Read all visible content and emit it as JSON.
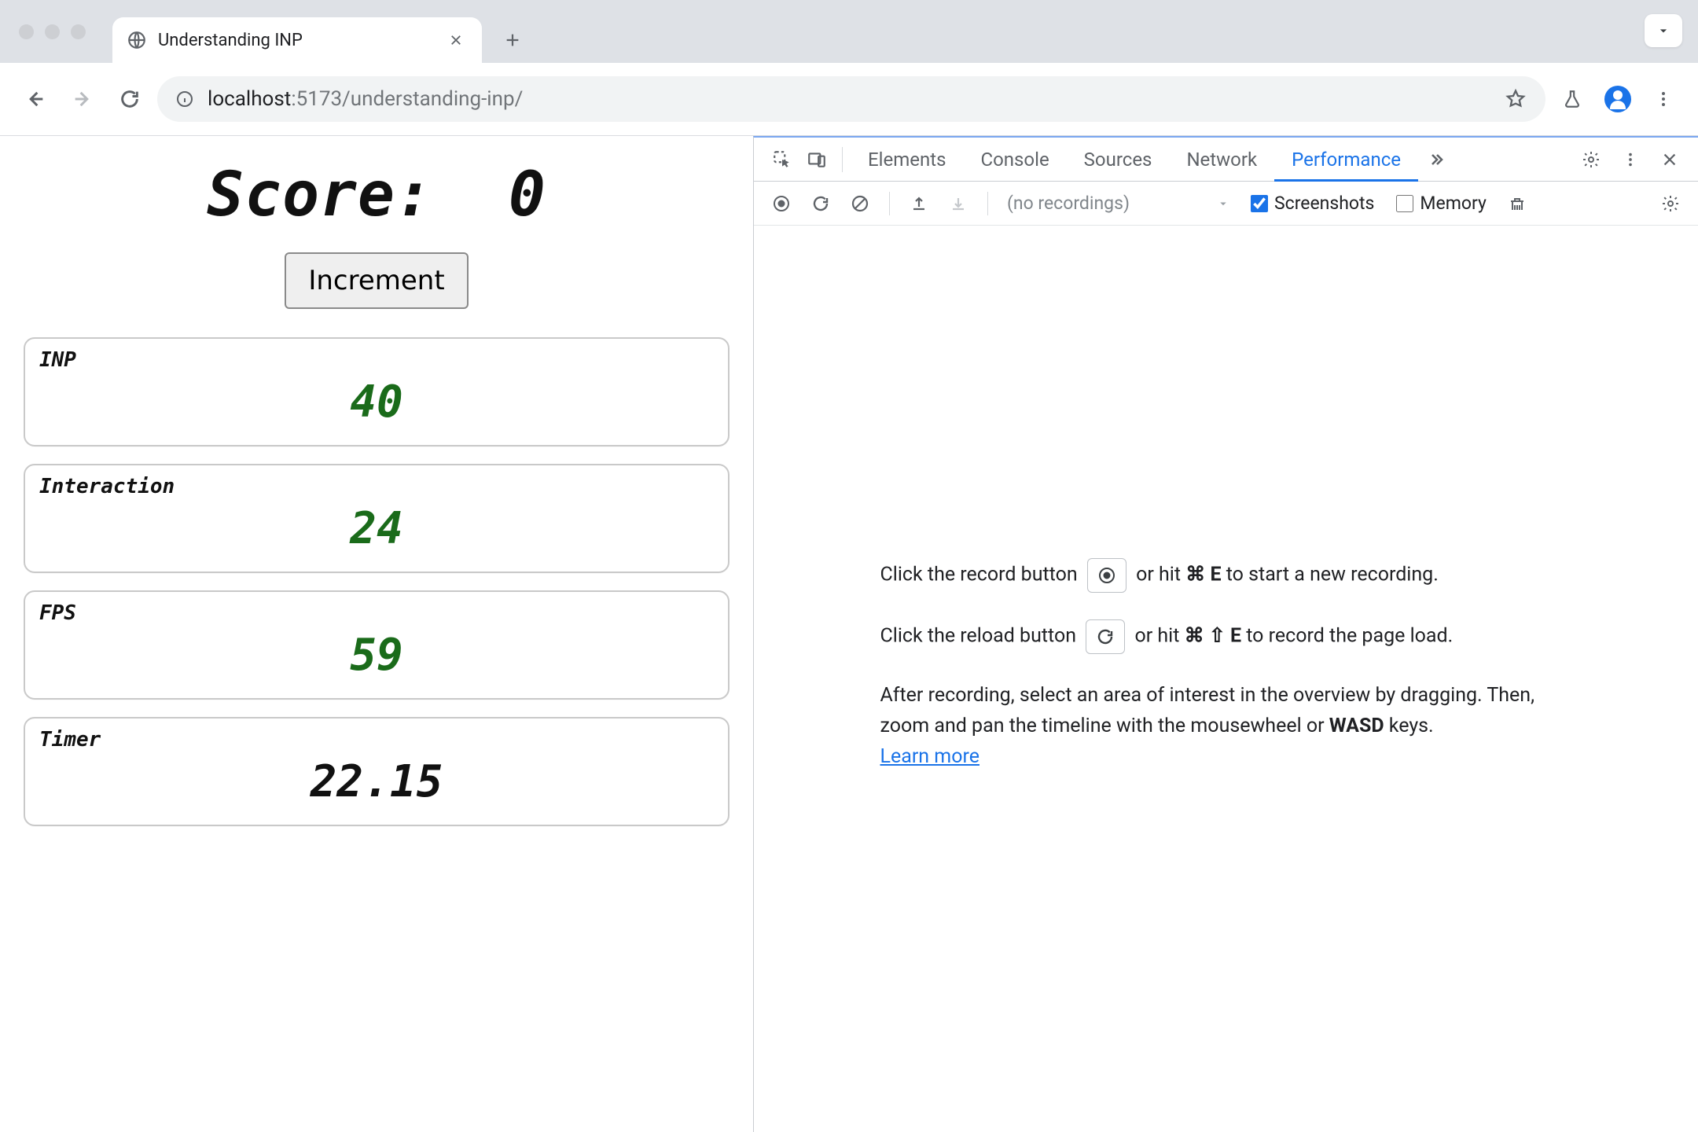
{
  "browser": {
    "tab_title": "Understanding INP",
    "url_host": "localhost",
    "url_port_path": ":5173/understanding-inp/"
  },
  "page": {
    "score_label": "Score:",
    "score_value": "0",
    "increment_label": "Increment",
    "cards": {
      "inp": {
        "label": "INP",
        "value": "40"
      },
      "interaction": {
        "label": "Interaction",
        "value": "24"
      },
      "fps": {
        "label": "FPS",
        "value": "59"
      },
      "timer": {
        "label": "Timer",
        "value": "22.15"
      }
    }
  },
  "devtools": {
    "tabs": {
      "elements": "Elements",
      "console": "Console",
      "sources": "Sources",
      "network": "Network",
      "performance": "Performance"
    },
    "toolbar": {
      "recordings_placeholder": "(no recordings)",
      "screenshots_label": "Screenshots",
      "memory_label": "Memory",
      "screenshots_checked": true,
      "memory_checked": false
    },
    "help": {
      "line1_a": "Click the record button ",
      "line1_b": " or hit ",
      "line1_key": "⌘ E",
      "line1_c": " to start a new recording.",
      "line2_a": "Click the reload button ",
      "line2_b": " or hit ",
      "line2_key": "⌘ ⇧ E",
      "line2_c": " to record the page load.",
      "line3_a": "After recording, select an area of interest in the overview by dragging. Then, zoom and pan the timeline with the mousewheel or ",
      "line3_bold": "WASD",
      "line3_b": " keys.",
      "learn_more": "Learn more"
    }
  }
}
